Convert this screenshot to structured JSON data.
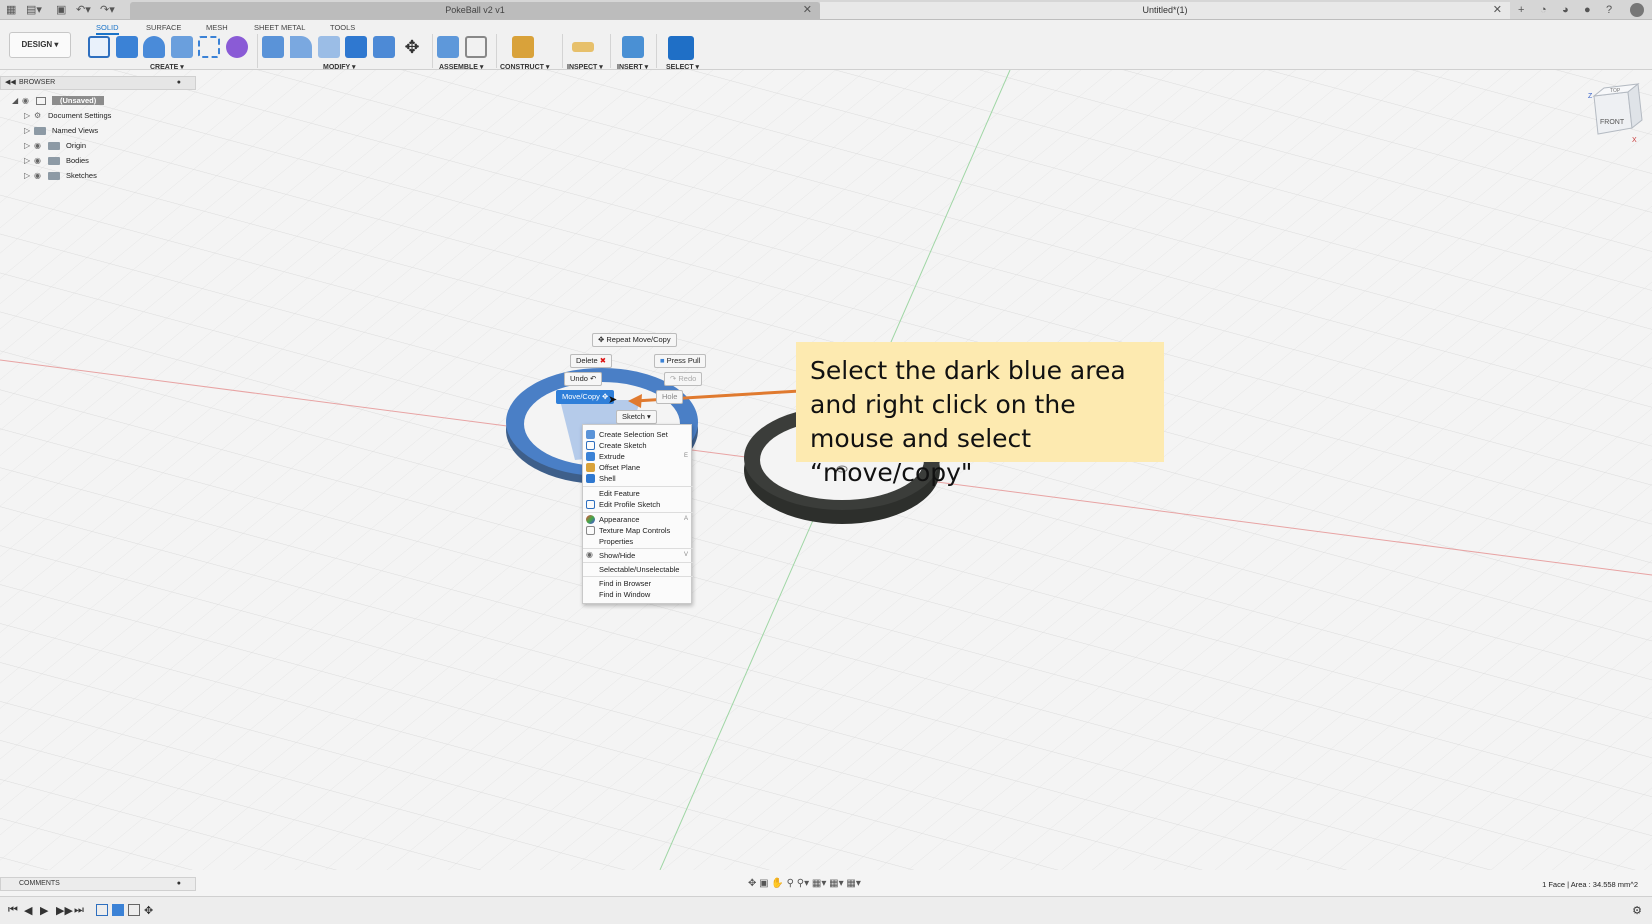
{
  "window": {
    "doc_tab_title": "PokeBall v2 v1",
    "second_tab_title": "Untitled*(1)",
    "close_glyph": "✕"
  },
  "toolbar": {
    "workspace_button": "DESIGN ▾",
    "tabs": [
      "SOLID",
      "SURFACE",
      "MESH",
      "SHEET METAL",
      "TOOLS"
    ],
    "groups": [
      "CREATE ▾",
      "MODIFY ▾",
      "ASSEMBLE ▾",
      "CONSTRUCT ▾",
      "INSPECT ▾",
      "INSERT ▾",
      "SELECT ▾"
    ]
  },
  "browser": {
    "title": "BROWSER",
    "items": [
      {
        "label": "(Unsaved)",
        "icon": "document-icon"
      },
      {
        "label": "Document Settings",
        "icon": "gear-icon"
      },
      {
        "label": "Named Views",
        "icon": "folder-icon"
      },
      {
        "label": "Origin",
        "icon": "folder-icon"
      },
      {
        "label": "Bodies",
        "icon": "folder-icon"
      },
      {
        "label": "Sketches",
        "icon": "folder-icon"
      }
    ]
  },
  "marking_menu": {
    "repeat": "Repeat Move/Copy",
    "delete": "Delete",
    "press_pull": "Press Pull",
    "undo": "Undo",
    "redo": "Redo",
    "move_copy": "Move/Copy",
    "hole": "Hole",
    "sketch": "Sketch ▾"
  },
  "context_menu": {
    "items": [
      "Create Selection Set",
      "Create Sketch",
      "Extrude",
      "Offset Plane",
      "Shell",
      "Edit Feature",
      "Edit Profile Sketch",
      "Appearance",
      "Texture Map Controls",
      "Properties",
      "Show/Hide",
      "Selectable/Unselectable",
      "Find in Browser",
      "Find in Window"
    ],
    "shortcuts": {
      "extrude": "E",
      "appearance": "A",
      "show_hide": "V"
    }
  },
  "callout": {
    "text": "Select the dark blue area and right click on the mouse and select “move/copy\""
  },
  "viewcube": {
    "front": "FRONT",
    "top": "TOP",
    "axis_z": "Z",
    "axis_x": "X"
  },
  "comments": {
    "title": "COMMENTS"
  },
  "status": {
    "selection": "1 Face | Area : 34.558 mm^2"
  },
  "colors": {
    "accent": "#1a73c8",
    "ring_selected": "#4a7fc6",
    "ring_dark": "#3b3d3a",
    "callout_bg": "#fdeab0",
    "arrow": "#e07a2f"
  }
}
